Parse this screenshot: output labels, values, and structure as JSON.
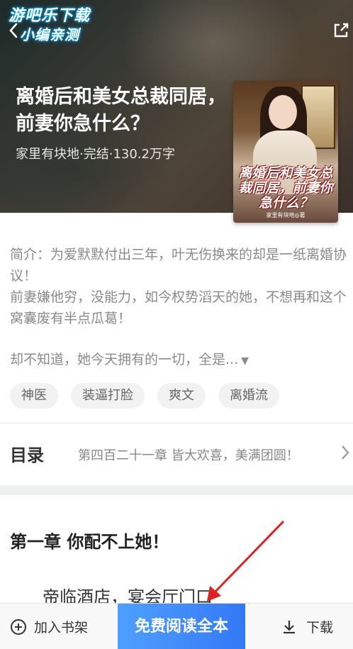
{
  "watermark": {
    "line1": "游吧乐下载",
    "line2": "小编亲测"
  },
  "book": {
    "title": "离婚后和美女总裁同居，前妻你急什么？",
    "meta": "家里有块地·完结·130.2万字",
    "cover_title": "离婚后和美女总裁同居，前妻你急什么？",
    "cover_author": "家里有块地◎著"
  },
  "intro": {
    "line1": "简介：为爱默默付出三年，叶无伤换来的却是一纸离婚协议！",
    "line2": "前妻嫌他穷，没能力，如今权势滔天的她，不想再和这个窝囊废有半点瓜葛！",
    "line3": "却不知道，她今天拥有的一切，全是..."
  },
  "tags": [
    "神医",
    "装逼打脸",
    "爽文",
    "离婚流"
  ],
  "toc": {
    "label": "目录",
    "latest": "第四百二十一章 皆大欢喜，美满团圆！"
  },
  "chapter": {
    "title": "第一章  你配不上她！",
    "body_start": "帝临酒店，宴会厅门口"
  },
  "bottom": {
    "add_shelf": "加入书架",
    "read_free": "免费阅读全本",
    "download": "下载"
  },
  "colors": {
    "accent": "#3478f6",
    "annotation": "#e02020"
  }
}
